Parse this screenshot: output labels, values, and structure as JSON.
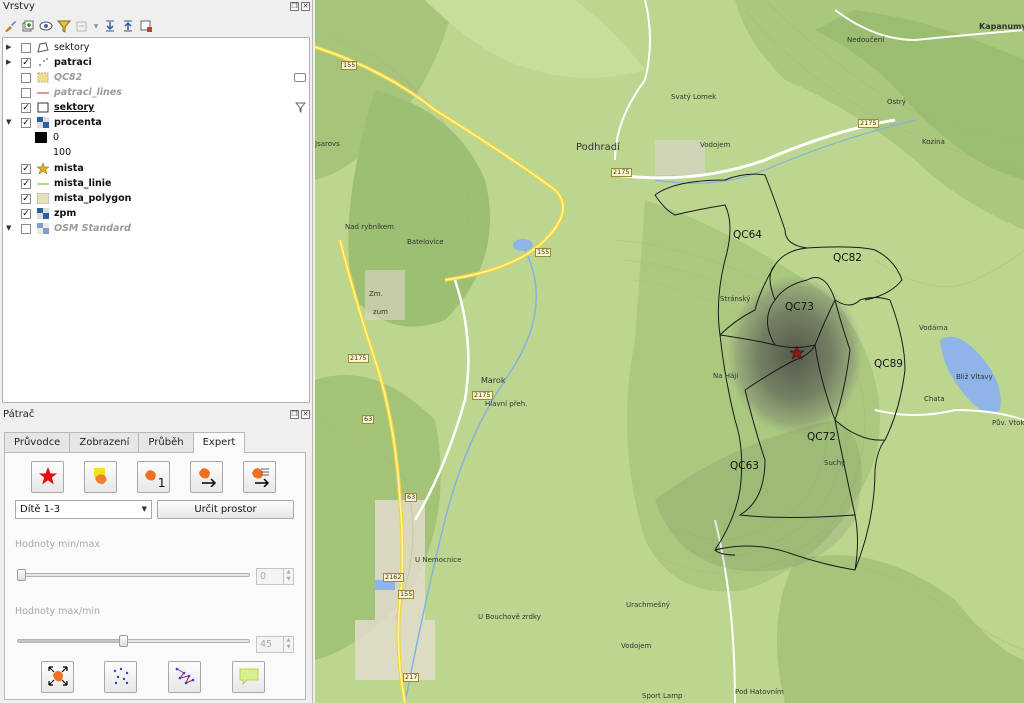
{
  "layers_panel": {
    "title": "Vrstvy",
    "items": [
      {
        "name": "sektory",
        "checked": false,
        "expander": "▶",
        "style": "normal",
        "icon": "polygon-outline-icon"
      },
      {
        "name": "patraci",
        "checked": true,
        "expander": "▶",
        "style": "bold",
        "icon": "points-icon"
      },
      {
        "name": "QC82",
        "checked": false,
        "expander": "",
        "style": "muted",
        "icon": "polygon-yellow-icon"
      },
      {
        "name": "patraci_lines",
        "checked": false,
        "expander": "",
        "style": "muted",
        "icon": "line-red-icon"
      },
      {
        "name": "sektory",
        "checked": true,
        "expander": "",
        "style": "bold-underline",
        "icon": "polygon-white-icon"
      },
      {
        "name": "procenta",
        "checked": true,
        "expander": "▼",
        "style": "bold",
        "icon": "raster-icon"
      },
      {
        "name": "0",
        "checked": null,
        "expander": "",
        "style": "legend",
        "icon": "black-square-icon"
      },
      {
        "name": "100",
        "checked": null,
        "expander": "",
        "style": "legend",
        "icon": ""
      },
      {
        "name": "mista",
        "checked": true,
        "expander": "",
        "style": "bold",
        "icon": "star-icon"
      },
      {
        "name": "mista_linie",
        "checked": true,
        "expander": "",
        "style": "bold",
        "icon": "line-green-icon"
      },
      {
        "name": "mista_polygon",
        "checked": true,
        "expander": "",
        "style": "bold",
        "icon": "polygon-beige-icon"
      },
      {
        "name": "zpm",
        "checked": true,
        "expander": "",
        "style": "bold",
        "icon": "raster-icon"
      },
      {
        "name": "OSM Standard",
        "checked": false,
        "expander": "▼",
        "style": "muted",
        "icon": "raster-icon"
      }
    ]
  },
  "patrac_panel": {
    "title": "Pátrač",
    "tabs": [
      "Průvodce",
      "Zobrazení",
      "Průběh",
      "Expert"
    ],
    "active_tab": "Expert",
    "combo_value": "Dítě 1-3",
    "button_label": "Určit prostor",
    "minmax_label": "Hodnoty min/max",
    "minmax_value": "0",
    "minmax_fraction": 0.0,
    "maxmin_label": "Hodnoty max/min",
    "maxmin_value": "45",
    "maxmin_fraction": 0.45,
    "tool_sub_number": "1"
  },
  "map": {
    "sectors": [
      "QC64",
      "QC82",
      "QC73",
      "QC89",
      "QC72",
      "QC63"
    ],
    "places": [
      "Podhradí",
      "Kapanumy",
      "Marok",
      "Vodojem",
      "Stránský",
      "Zm.",
      "zum",
      "Batelovice",
      "Ostrý",
      "Kozina",
      "Vodárna",
      "Nedoučení",
      "Chata",
      "Vodojem",
      "Sport",
      "Lamp",
      "Urachmešný",
      "U Bouchově zrdky",
      "Pod Hatovním",
      "Suchý",
      "Svatý Lomek",
      "Pův. Vtoka",
      "Jsarovs",
      "Na Háji",
      "U Nemocnice",
      "Hlavní přeh.",
      "Bliž Vltavy",
      "Nad rybníkem"
    ],
    "road_numbers": [
      "155",
      "2175",
      "2175",
      "155",
      "2175",
      "2175",
      "155",
      "63",
      "63",
      "2162",
      "155",
      "217"
    ]
  }
}
